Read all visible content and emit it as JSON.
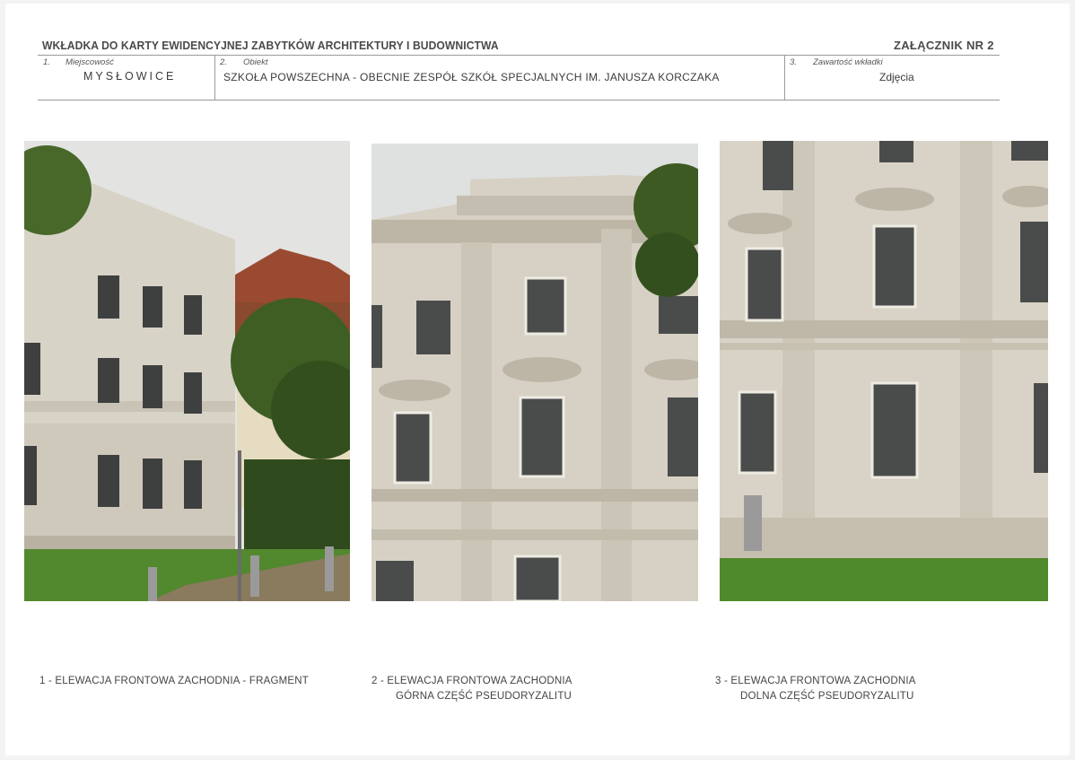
{
  "header": {
    "title": "WKŁADKA DO KARTY EWIDENCYJNEJ ZABYTKÓW ARCHITEKTURY I BUDOWNICTWA",
    "annex": "ZAŁĄCZNIK NR 2"
  },
  "fields": {
    "f1": {
      "number": "1.",
      "label": "Miejscowość",
      "value": "MYSŁOWICE"
    },
    "f2": {
      "number": "2.",
      "label": "Obiekt",
      "value": "SZKOŁA POWSZECHNA - OBECNIE ZESPÓŁ SZKÓŁ SPECJALNYCH IM. JANUSZA KORCZAKA"
    },
    "f3": {
      "number": "3.",
      "label": "Zawartość wkładki",
      "value": "Zdjęcia"
    }
  },
  "captions": {
    "c1": {
      "line1": "1 - ELEWACJA FRONTOWA ZACHODNIA - FRAGMENT",
      "line2": ""
    },
    "c2": {
      "line1": "2 - ELEWACJA FRONTOWA ZACHODNIA",
      "line2": "GÓRNA CZĘŚĆ PSEUDORYZALITU"
    },
    "c3": {
      "line1": "3 - ELEWACJA FRONTOWA ZACHODNIA",
      "line2": "DOLNA CZĘŚĆ PSEUDORYZALITU"
    }
  },
  "colors": {
    "facade": "#d9d5c8",
    "sky": "#dcdcdc",
    "grass": "#4f8a2c",
    "tree": "#3d5e22",
    "roof": "#8a4b34"
  }
}
